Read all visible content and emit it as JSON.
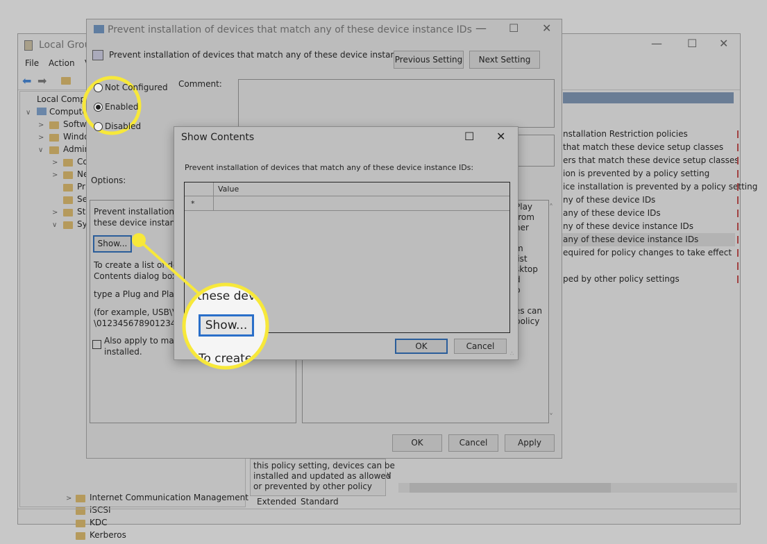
{
  "gp_window": {
    "title": "Local Grou",
    "menu": [
      "File",
      "Action",
      "V"
    ],
    "tree": [
      {
        "label": "Local Compu",
        "type": "root"
      },
      {
        "label": "Compute",
        "chev": "v"
      },
      {
        "label": "Softwa",
        "chev": ">"
      },
      {
        "label": "Windo",
        "chev": ">"
      },
      {
        "label": "Admin",
        "chev": "v"
      },
      {
        "label": "Co",
        "chev": ">"
      },
      {
        "label": "Ne",
        "chev": ">"
      },
      {
        "label": "Pri"
      },
      {
        "label": "Ser"
      },
      {
        "label": "Sta",
        "chev": ">"
      },
      {
        "label": "Sys",
        "chev": "v"
      }
    ],
    "tree_bottom": [
      "Internet Communication Management",
      "iSCSI",
      "KDC",
      "Kerberos"
    ],
    "list_items": [
      "nstallation Restriction policies",
      "that match these device setup classes",
      "ers that match these device setup classes",
      "ion is prevented by a policy setting",
      "ice installation is prevented by a policy setting",
      "ny of these device IDs",
      "any of these device IDs",
      "ny of these device instance IDs",
      "any of these device instance IDs",
      "equired for policy changes to take effect",
      "",
      "ped by other policy settings"
    ],
    "selected_list_index": 8,
    "extended_text": [
      "this policy setting, devices can be",
      "installed and updated as allowed",
      "or prevented by other policy"
    ],
    "tabs": [
      "Extended",
      "Standard"
    ]
  },
  "policy_dialog": {
    "title": "Prevent installation of devices that match any of these device instance IDs",
    "setting_name": "Prevent installation of devices that match any of these device instance IDs",
    "previous_label": "Previous Setting",
    "next_label": "Next Setting",
    "radios": [
      {
        "label": "Not Configured",
        "checked": false
      },
      {
        "label": "Enabled",
        "checked": true
      },
      {
        "label": "Disabled",
        "checked": false
      }
    ],
    "comment_label": "Comment:",
    "options_label": "Options:",
    "options_text": [
      "Prevent installation of",
      "these device instance I"
    ],
    "show_label": "Show...",
    "options_text2": [
      "To create a list of devic",
      "Contents dialog box, i",
      "type a Plug and Play d",
      "(for example, USB\\VID_",
      "\\0123456789012345"
    ],
    "checkbox_label": [
      "Also apply to match",
      "installed."
    ],
    "checkbox_checked": false,
    "help_text": [
      "Play",
      "from",
      "her",
      "",
      "m",
      "list",
      "sktop",
      "d",
      "p",
      "",
      "es can",
      "policy"
    ],
    "ok": "OK",
    "cancel": "Cancel",
    "apply": "Apply"
  },
  "show_contents": {
    "title": "Show Contents",
    "description": "Prevent installation of devices that match any of these device instance IDs:",
    "column_header": "Value",
    "row_marker": "*",
    "ok": "OK",
    "cancel": "Cancel"
  },
  "callout": {
    "zoom_text_top": "these devi",
    "zoom_button": "Show...",
    "zoom_text_bottom": "To create",
    "color": "#f7e83a"
  }
}
